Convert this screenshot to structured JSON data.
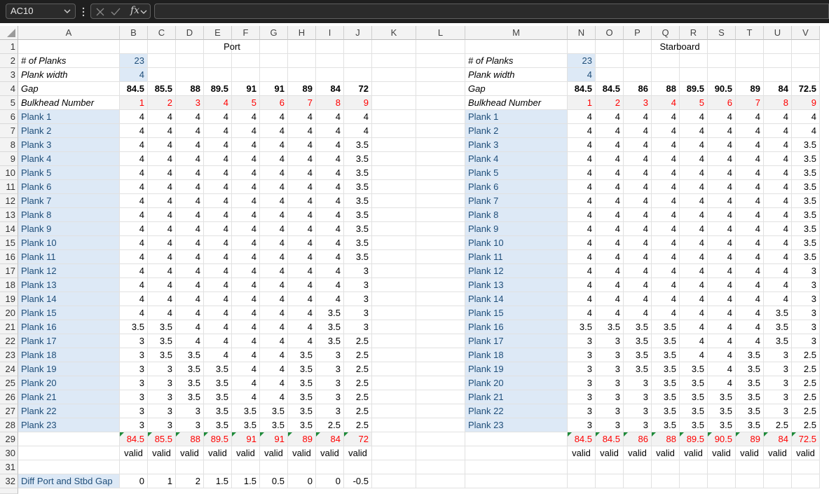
{
  "formula_bar": {
    "name_box": "AC10",
    "fx_label": "fx",
    "formula": ""
  },
  "columns": [
    "A",
    "B",
    "C",
    "D",
    "E",
    "F",
    "G",
    "H",
    "I",
    "J",
    "K",
    "L",
    "M",
    "N",
    "O",
    "P",
    "Q",
    "R",
    "S",
    "T",
    "U",
    "V"
  ],
  "rows": [
    "1",
    "2",
    "3",
    "4",
    "5",
    "6",
    "7",
    "8",
    "9",
    "10",
    "11",
    "12",
    "13",
    "14",
    "15",
    "16",
    "17",
    "18",
    "19",
    "20",
    "21",
    "22",
    "23",
    "24",
    "25",
    "26",
    "27",
    "28",
    "29",
    "30",
    "31",
    "32"
  ],
  "port": {
    "title": "Port",
    "num_planks_label": "# of Planks",
    "num_planks": "23",
    "plank_width_label": "Plank width",
    "plank_width": "4",
    "gap_label": "Gap",
    "gaps": [
      "84.5",
      "85.5",
      "88",
      "89.5",
      "91",
      "91",
      "89",
      "84",
      "72"
    ],
    "bulkhead_label": "Bulkhead Number",
    "bulkheads": [
      "1",
      "2",
      "3",
      "4",
      "5",
      "6",
      "7",
      "8",
      "9"
    ],
    "plank_labels": [
      "Plank 1",
      "Plank 2",
      "Plank 3",
      "Plank 4",
      "Plank 5",
      "Plank 6",
      "Plank 7",
      "Plank 8",
      "Plank 9",
      "Plank 10",
      "Plank 11",
      "Plank 12",
      "Plank 13",
      "Plank 14",
      "Plank 15",
      "Plank 16",
      "Plank 17",
      "Plank 18",
      "Plank 19",
      "Plank 20",
      "Plank 21",
      "Plank 22",
      "Plank 23"
    ],
    "planks": [
      [
        "4",
        "4",
        "4",
        "4",
        "4",
        "4",
        "4",
        "4",
        "4"
      ],
      [
        "4",
        "4",
        "4",
        "4",
        "4",
        "4",
        "4",
        "4",
        "4"
      ],
      [
        "4",
        "4",
        "4",
        "4",
        "4",
        "4",
        "4",
        "4",
        "3.5"
      ],
      [
        "4",
        "4",
        "4",
        "4",
        "4",
        "4",
        "4",
        "4",
        "3.5"
      ],
      [
        "4",
        "4",
        "4",
        "4",
        "4",
        "4",
        "4",
        "4",
        "3.5"
      ],
      [
        "4",
        "4",
        "4",
        "4",
        "4",
        "4",
        "4",
        "4",
        "3.5"
      ],
      [
        "4",
        "4",
        "4",
        "4",
        "4",
        "4",
        "4",
        "4",
        "3.5"
      ],
      [
        "4",
        "4",
        "4",
        "4",
        "4",
        "4",
        "4",
        "4",
        "3.5"
      ],
      [
        "4",
        "4",
        "4",
        "4",
        "4",
        "4",
        "4",
        "4",
        "3.5"
      ],
      [
        "4",
        "4",
        "4",
        "4",
        "4",
        "4",
        "4",
        "4",
        "3.5"
      ],
      [
        "4",
        "4",
        "4",
        "4",
        "4",
        "4",
        "4",
        "4",
        "3.5"
      ],
      [
        "4",
        "4",
        "4",
        "4",
        "4",
        "4",
        "4",
        "4",
        "3"
      ],
      [
        "4",
        "4",
        "4",
        "4",
        "4",
        "4",
        "4",
        "4",
        "3"
      ],
      [
        "4",
        "4",
        "4",
        "4",
        "4",
        "4",
        "4",
        "4",
        "3"
      ],
      [
        "4",
        "4",
        "4",
        "4",
        "4",
        "4",
        "4",
        "3.5",
        "3"
      ],
      [
        "3.5",
        "3.5",
        "4",
        "4",
        "4",
        "4",
        "4",
        "3.5",
        "3"
      ],
      [
        "3",
        "3.5",
        "4",
        "4",
        "4",
        "4",
        "4",
        "3.5",
        "2.5"
      ],
      [
        "3",
        "3.5",
        "3.5",
        "4",
        "4",
        "4",
        "3.5",
        "3",
        "2.5"
      ],
      [
        "3",
        "3",
        "3.5",
        "3.5",
        "4",
        "4",
        "3.5",
        "3",
        "2.5"
      ],
      [
        "3",
        "3",
        "3.5",
        "3.5",
        "4",
        "4",
        "3.5",
        "3",
        "2.5"
      ],
      [
        "3",
        "3",
        "3.5",
        "3.5",
        "4",
        "4",
        "3.5",
        "3",
        "2.5"
      ],
      [
        "3",
        "3",
        "3",
        "3.5",
        "3.5",
        "3.5",
        "3.5",
        "3",
        "2.5"
      ],
      [
        "3",
        "3",
        "3",
        "3.5",
        "3.5",
        "3.5",
        "3.5",
        "2.5",
        "2.5"
      ]
    ],
    "totals": [
      "84.5",
      "85.5",
      "88",
      "89.5",
      "91",
      "91",
      "89",
      "84",
      "72"
    ],
    "valid": [
      "valid",
      "valid",
      "valid",
      "valid",
      "valid",
      "valid",
      "valid",
      "valid",
      "valid"
    ],
    "diff_label": "Diff Port and Stbd Gap",
    "diffs": [
      "0",
      "1",
      "2",
      "1.5",
      "1.5",
      "0.5",
      "0",
      "0",
      "-0.5"
    ]
  },
  "starboard": {
    "title": "Starboard",
    "num_planks_label": "# of Planks",
    "num_planks": "23",
    "plank_width_label": "Plank width",
    "plank_width": "4",
    "gap_label": "Gap",
    "gaps": [
      "84.5",
      "84.5",
      "86",
      "88",
      "89.5",
      "90.5",
      "89",
      "84",
      "72.5"
    ],
    "bulkhead_label": "Bulkhead Number",
    "bulkheads": [
      "1",
      "2",
      "3",
      "4",
      "5",
      "6",
      "7",
      "8",
      "9"
    ],
    "plank_labels": [
      "Plank 1",
      "Plank 2",
      "Plank 3",
      "Plank 4",
      "Plank 5",
      "Plank 6",
      "Plank 7",
      "Plank 8",
      "Plank 9",
      "Plank 10",
      "Plank 11",
      "Plank 12",
      "Plank 13",
      "Plank 14",
      "Plank 15",
      "Plank 16",
      "Plank 17",
      "Plank 18",
      "Plank 19",
      "Plank 20",
      "Plank 21",
      "Plank 22",
      "Plank 23"
    ],
    "planks": [
      [
        "4",
        "4",
        "4",
        "4",
        "4",
        "4",
        "4",
        "4",
        "4"
      ],
      [
        "4",
        "4",
        "4",
        "4",
        "4",
        "4",
        "4",
        "4",
        "4"
      ],
      [
        "4",
        "4",
        "4",
        "4",
        "4",
        "4",
        "4",
        "4",
        "3.5"
      ],
      [
        "4",
        "4",
        "4",
        "4",
        "4",
        "4",
        "4",
        "4",
        "3.5"
      ],
      [
        "4",
        "4",
        "4",
        "4",
        "4",
        "4",
        "4",
        "4",
        "3.5"
      ],
      [
        "4",
        "4",
        "4",
        "4",
        "4",
        "4",
        "4",
        "4",
        "3.5"
      ],
      [
        "4",
        "4",
        "4",
        "4",
        "4",
        "4",
        "4",
        "4",
        "3.5"
      ],
      [
        "4",
        "4",
        "4",
        "4",
        "4",
        "4",
        "4",
        "4",
        "3.5"
      ],
      [
        "4",
        "4",
        "4",
        "4",
        "4",
        "4",
        "4",
        "4",
        "3.5"
      ],
      [
        "4",
        "4",
        "4",
        "4",
        "4",
        "4",
        "4",
        "4",
        "3.5"
      ],
      [
        "4",
        "4",
        "4",
        "4",
        "4",
        "4",
        "4",
        "4",
        "3.5"
      ],
      [
        "4",
        "4",
        "4",
        "4",
        "4",
        "4",
        "4",
        "4",
        "3"
      ],
      [
        "4",
        "4",
        "4",
        "4",
        "4",
        "4",
        "4",
        "4",
        "3"
      ],
      [
        "4",
        "4",
        "4",
        "4",
        "4",
        "4",
        "4",
        "4",
        "3"
      ],
      [
        "4",
        "4",
        "4",
        "4",
        "4",
        "4",
        "4",
        "3.5",
        "3"
      ],
      [
        "3.5",
        "3.5",
        "3.5",
        "3.5",
        "4",
        "4",
        "4",
        "3.5",
        "3"
      ],
      [
        "3",
        "3",
        "3.5",
        "3.5",
        "4",
        "4",
        "4",
        "3.5",
        "3"
      ],
      [
        "3",
        "3",
        "3.5",
        "3.5",
        "4",
        "4",
        "3.5",
        "3",
        "2.5"
      ],
      [
        "3",
        "3",
        "3.5",
        "3.5",
        "3.5",
        "4",
        "3.5",
        "3",
        "2.5"
      ],
      [
        "3",
        "3",
        "3",
        "3.5",
        "3.5",
        "4",
        "3.5",
        "3",
        "2.5"
      ],
      [
        "3",
        "3",
        "3",
        "3.5",
        "3.5",
        "3.5",
        "3.5",
        "3",
        "2.5"
      ],
      [
        "3",
        "3",
        "3",
        "3.5",
        "3.5",
        "3.5",
        "3.5",
        "3",
        "2.5"
      ],
      [
        "3",
        "3",
        "3",
        "3.5",
        "3.5",
        "3.5",
        "3.5",
        "2.5",
        "2.5"
      ]
    ],
    "totals": [
      "84.5",
      "84.5",
      "86",
      "88",
      "89.5",
      "90.5",
      "89",
      "84",
      "72.5"
    ],
    "valid": [
      "valid",
      "valid",
      "valid",
      "valid",
      "valid",
      "valid",
      "valid",
      "valid",
      "valid"
    ]
  },
  "colors": {
    "label_blue_fill": "#dde9f6",
    "label_blue_text": "#1f4e79",
    "red_text": "#ff0000",
    "triangle_green": "#1e8b3a"
  }
}
